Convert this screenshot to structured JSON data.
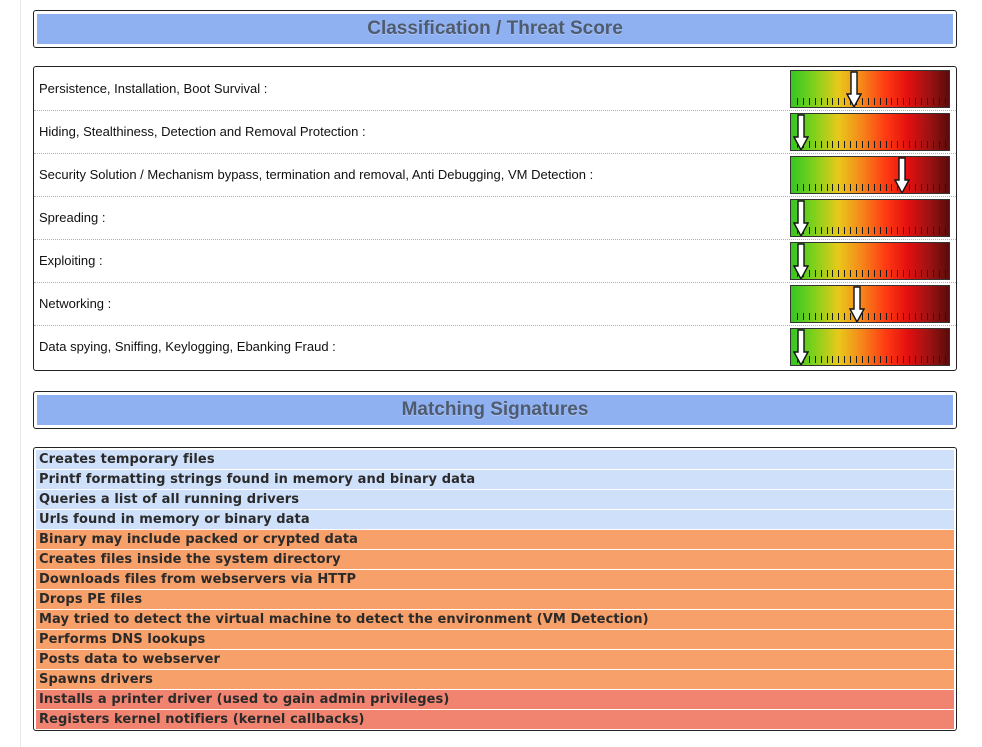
{
  "classification": {
    "title": "Classification / Threat Score",
    "rows": [
      {
        "label": "Persistence, Installation, Boot Survival :",
        "level": 0.38
      },
      {
        "label": "Hiding, Stealthiness, Detection and Removal Protection :",
        "level": 0.0
      },
      {
        "label": "Security Solution / Mechanism bypass, termination and removal, Anti Debugging, VM Detection :",
        "level": 0.72
      },
      {
        "label": "Spreading :",
        "level": 0.0
      },
      {
        "label": "Exploiting :",
        "level": 0.0
      },
      {
        "label": "Networking :",
        "level": 0.4
      },
      {
        "label": "Data spying, Sniffing, Keylogging, Ebanking Fraud :",
        "level": 0.0
      }
    ]
  },
  "signatures": {
    "title": "Matching Signatures",
    "items": [
      {
        "text": "Creates temporary files",
        "severity": "info"
      },
      {
        "text": "Printf formatting strings found in memory and binary data",
        "severity": "info"
      },
      {
        "text": "Queries a list of all running drivers",
        "severity": "info"
      },
      {
        "text": "Urls found in memory or binary data",
        "severity": "info"
      },
      {
        "text": "Binary may include packed or crypted data",
        "severity": "warn"
      },
      {
        "text": "Creates files inside the system directory",
        "severity": "warn"
      },
      {
        "text": "Downloads files from webservers via HTTP",
        "severity": "warn"
      },
      {
        "text": "Drops PE files",
        "severity": "warn"
      },
      {
        "text": "May tried to detect the virtual machine to detect the environment (VM Detection)",
        "severity": "warn"
      },
      {
        "text": "Performs DNS lookups",
        "severity": "warn"
      },
      {
        "text": "Posts data to webserver",
        "severity": "warn"
      },
      {
        "text": "Spawns drivers",
        "severity": "warn"
      },
      {
        "text": "Installs a printer driver (used to gain admin privileges)",
        "severity": "crit"
      },
      {
        "text": "Registers kernel notifiers (kernel callbacks)",
        "severity": "crit"
      }
    ]
  },
  "colors": {
    "header_bar": "#8fb1f2",
    "info": "#cfe0fa",
    "warn": "#f7a06a",
    "crit": "#f08471"
  },
  "icons": {
    "meter_pointer": "down-arrow-icon"
  }
}
